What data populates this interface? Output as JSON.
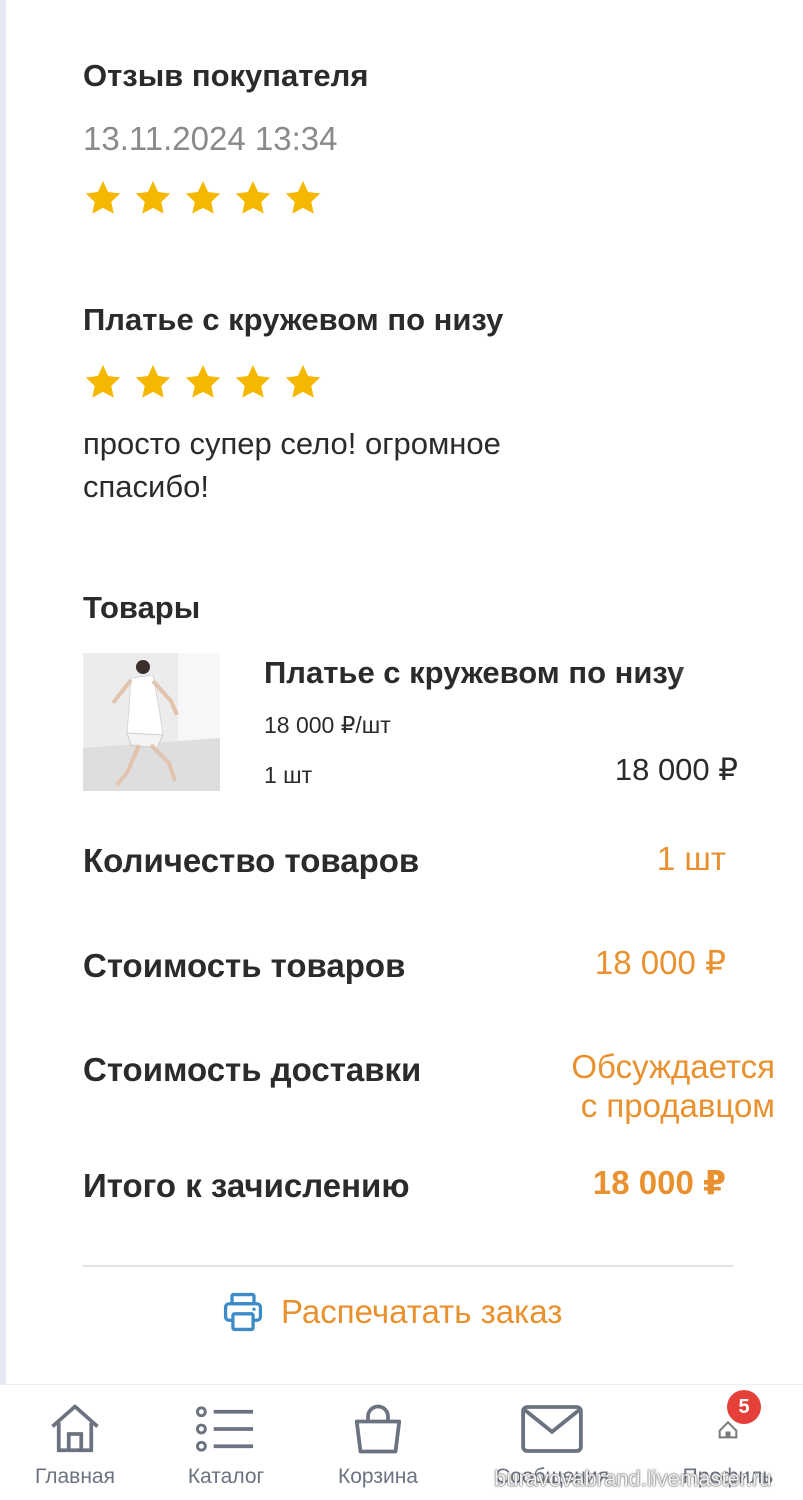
{
  "review": {
    "title": "Отзыв покупателя",
    "datetime": "13.11.2024 13:34",
    "rating": 5
  },
  "product_review": {
    "title": "Платье с кружевом по низу",
    "rating": 5,
    "text_line1": "просто супер село! огромное",
    "text_line2": "спасибо!"
  },
  "goods": {
    "title": "Товары",
    "item": {
      "name": "Платье с кружевом по низу",
      "unit_price": "18 000 ₽/шт",
      "qty": "1 шт",
      "total": "18 000 ₽"
    }
  },
  "summary": {
    "qty_label": "Количество товаров",
    "qty_value": "1 шт",
    "cost_label": "Стоимость товаров",
    "cost_value": "18 000 ₽",
    "delivery_label": "Стоимость доставки",
    "delivery_value_line1": "Обсуждается",
    "delivery_value_line2": "с продавцом",
    "total_label": "Итого к зачислению",
    "total_value": "18 000 ₽"
  },
  "print_label": "Распечатать заказ",
  "nav": {
    "home": "Главная",
    "catalog": "Каталог",
    "cart": "Корзина",
    "messages": "Сообщения",
    "profile": "Профиль",
    "badge_count": "5"
  },
  "watermark": "buravovabrand.livemaster.ru",
  "colors": {
    "star": "#f5b800",
    "accent": "#e8912e",
    "print_icon": "#3d8bc7",
    "badge": "#e5413a"
  }
}
